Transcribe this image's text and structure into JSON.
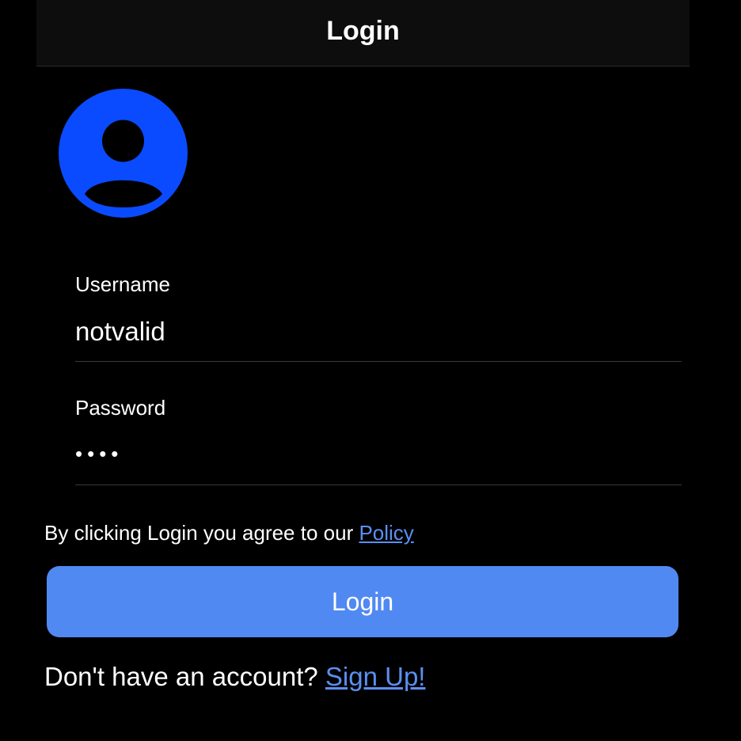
{
  "nav": {
    "title": "Login"
  },
  "avatar": {
    "icon": "person-circle-icon",
    "color": "#0a4bff"
  },
  "form": {
    "username": {
      "label": "Username",
      "value": "notvalid"
    },
    "password": {
      "label": "Password",
      "value": "••••"
    }
  },
  "policy": {
    "text": "By clicking Login you agree to our ",
    "link_label": "Policy"
  },
  "login_button": {
    "label": "Login",
    "color": "#5189f2"
  },
  "signup": {
    "text": "Don't have an account? ",
    "link_label": "Sign Up!"
  },
  "colors": {
    "background": "#000000",
    "link": "#5b8ff2"
  }
}
